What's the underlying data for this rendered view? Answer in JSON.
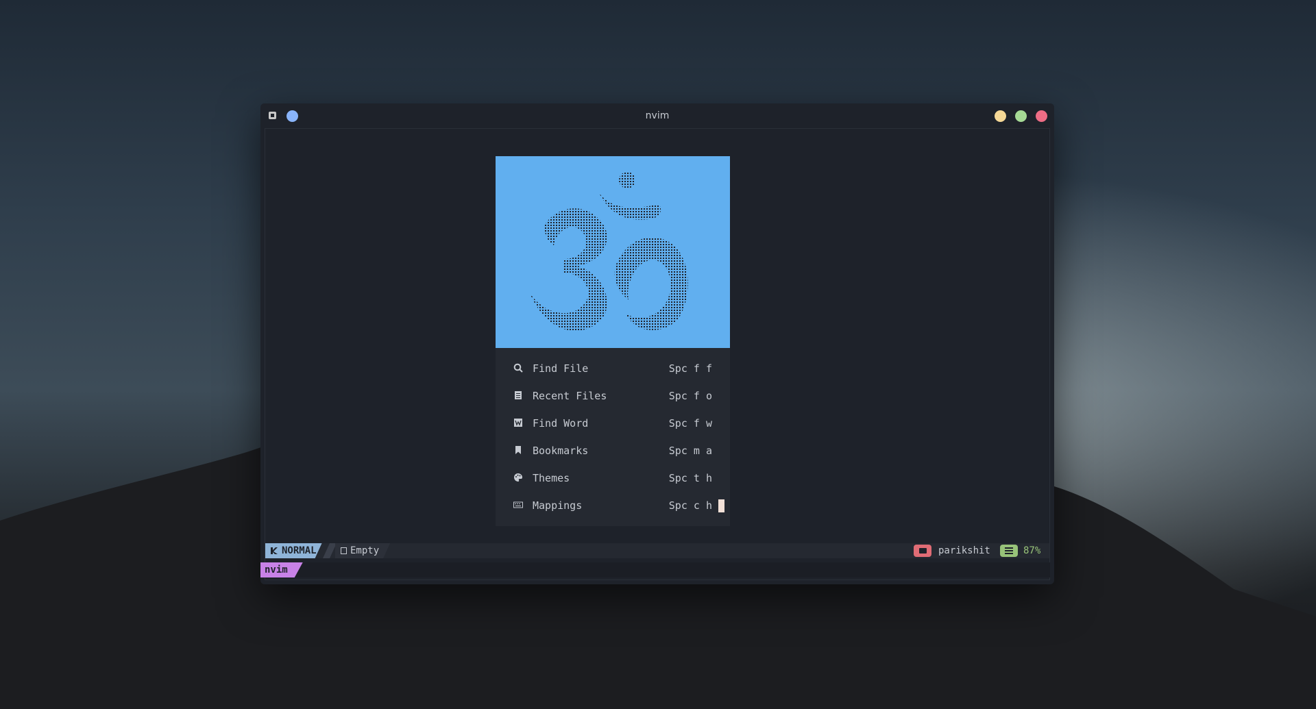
{
  "window": {
    "title": "nvim",
    "buttons": {
      "left_dot_color": "#89b4fa",
      "minimize_color": "#f5d896",
      "maximize_color": "#a6da95",
      "close_color": "#ee6d85"
    }
  },
  "dashboard": {
    "header_icon": "om-ascii-art",
    "header_bg": "#61afef",
    "items": [
      {
        "icon": "search-icon",
        "label": "Find File",
        "key": "Spc f f"
      },
      {
        "icon": "file-icon",
        "label": "Recent Files",
        "key": "Spc f o"
      },
      {
        "icon": "word-icon",
        "label": "Find Word",
        "key": "Spc f w"
      },
      {
        "icon": "bookmark-icon",
        "label": "Bookmarks",
        "key": "Spc m a"
      },
      {
        "icon": "palette-icon",
        "label": "Themes",
        "key": "Spc t h"
      },
      {
        "icon": "keyboard-icon",
        "label": "Mappings",
        "key": "Spc c h"
      }
    ]
  },
  "statusline": {
    "mode": "NORMAL",
    "file": "Empty",
    "directory": "parikshit",
    "percent": "87%"
  },
  "tabline": {
    "active_tab": "nvim"
  }
}
